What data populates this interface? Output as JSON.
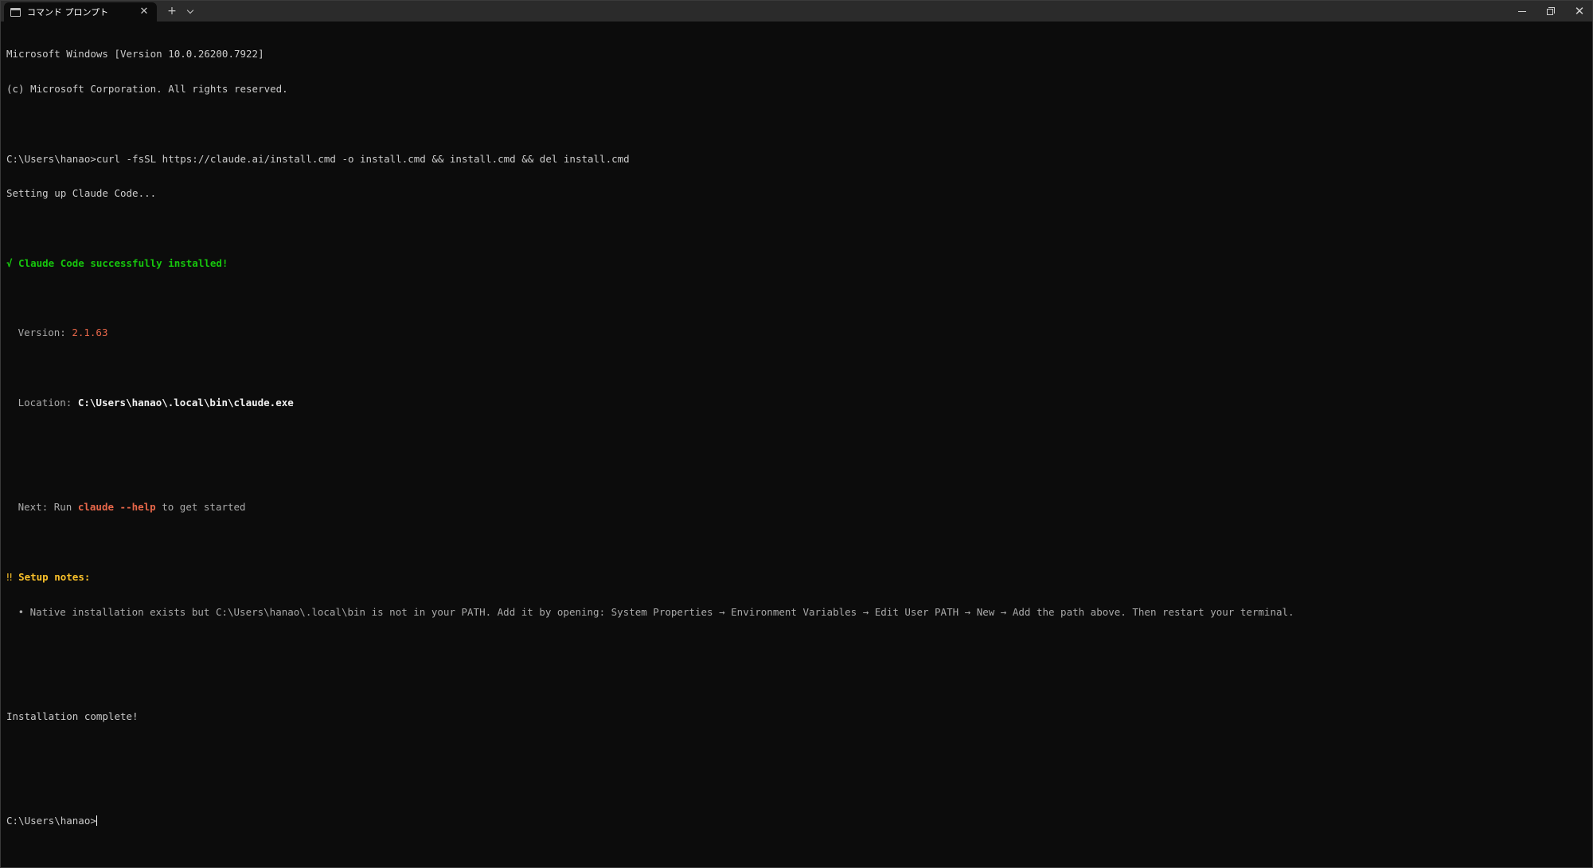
{
  "window": {
    "tab_title": "コマンド プロンプト",
    "tab_close_glyph": "✕",
    "new_tab_glyph": "+",
    "close_glyph": "✕"
  },
  "console": {
    "banner1": "Microsoft Windows [Version 10.0.26200.7922]",
    "banner2": "(c) Microsoft Corporation. All rights reserved.",
    "prompt1": "C:\\Users\\hanao>",
    "command": "curl -fsSL https://claude.ai/install.cmd -o install.cmd && install.cmd && del install.cmd",
    "setup": "Setting up Claude Code...",
    "success": "√ Claude Code successfully installed!",
    "version_label": "Version: ",
    "version_value": "2.1.63",
    "location_label": "Location: ",
    "location_value": "C:\\Users\\hanao\\.local\\bin\\claude.exe",
    "next_prefix": "Next: Run ",
    "next_cmd": "claude --help",
    "next_suffix": " to get started",
    "notes_icon": "‼ ",
    "notes_label": "Setup notes:",
    "note1": "• Native installation exists but C:\\Users\\hanao\\.local\\bin is not in your PATH. Add it by opening: System Properties → Environment Variables → Edit User PATH → New → Add the path above. Then restart your terminal.",
    "complete": "Installation complete!",
    "prompt2": "C:\\Users\\hanao>"
  },
  "colors": {
    "background": "#0c0c0c",
    "titlebar": "#2b2b2b",
    "success_green": "#16c60c",
    "accent_orange": "#e8674a",
    "warning_yellow": "#f9c02a"
  },
  "icons": [
    "terminal-icon",
    "close-icon",
    "plus-icon",
    "chevron-down-icon",
    "minimize-icon",
    "restore-icon"
  ]
}
